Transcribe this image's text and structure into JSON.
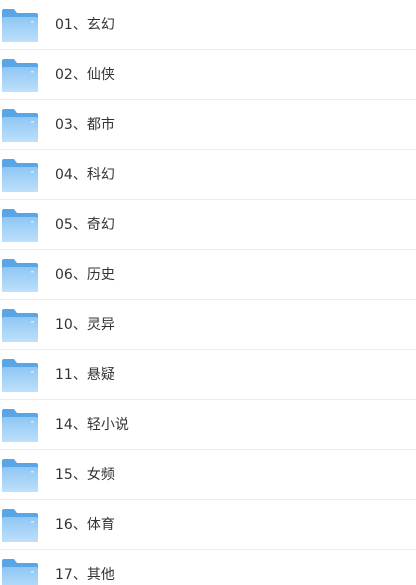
{
  "folders": [
    {
      "label": "01、玄幻",
      "icon": "folder-icon"
    },
    {
      "label": "02、仙侠",
      "icon": "folder-icon"
    },
    {
      "label": "03、都市",
      "icon": "folder-icon"
    },
    {
      "label": "04、科幻",
      "icon": "folder-icon"
    },
    {
      "label": "05、奇幻",
      "icon": "folder-icon"
    },
    {
      "label": "06、历史",
      "icon": "folder-icon"
    },
    {
      "label": "10、灵异",
      "icon": "folder-icon"
    },
    {
      "label": "11、悬疑",
      "icon": "folder-icon"
    },
    {
      "label": "14、轻小说",
      "icon": "folder-icon"
    },
    {
      "label": "15、女频",
      "icon": "folder-icon"
    },
    {
      "label": "16、体育",
      "icon": "folder-icon"
    },
    {
      "label": "17、其他",
      "icon": "folder-icon"
    }
  ],
  "colors": {
    "folder_back": "#5aa5e6",
    "folder_front_top": "#8ec6f4",
    "folder_front_bottom": "#bfe0fb",
    "text": "#333333",
    "divider": "#ececec"
  }
}
